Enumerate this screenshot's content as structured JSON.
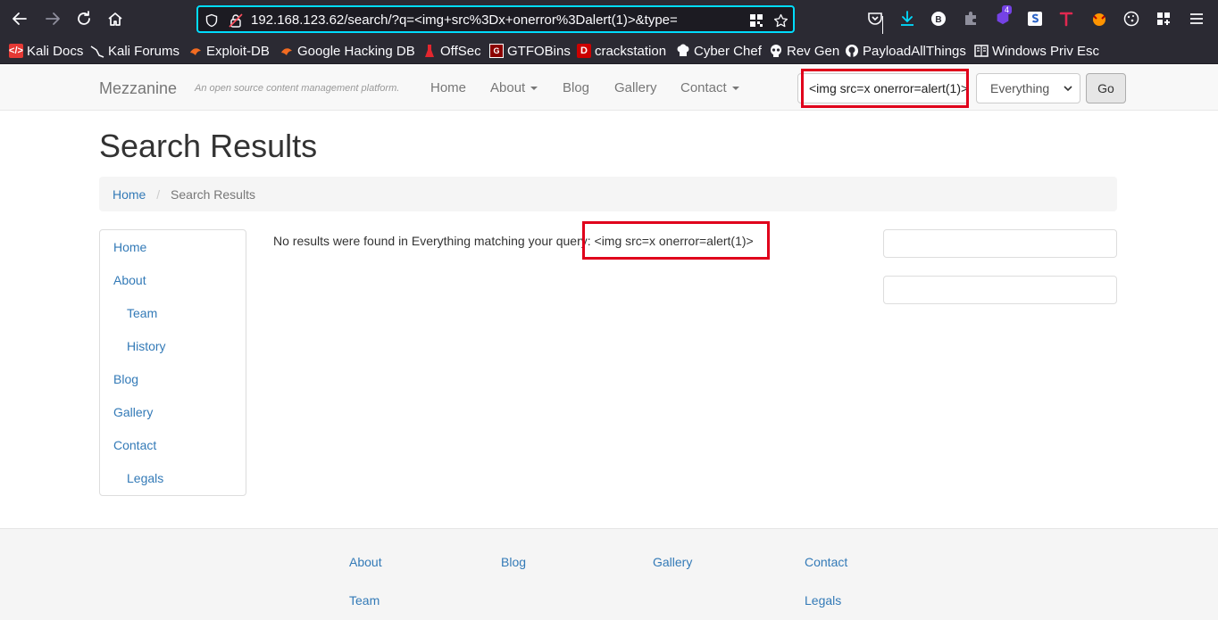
{
  "browser": {
    "url": "192.168.123.62/search/?q=<img+src%3Dx+onerror%3Dalert(1)>&type=",
    "extension_badge": "4",
    "bookmarks": [
      {
        "label": "Kali Docs"
      },
      {
        "label": "Kali Forums"
      },
      {
        "label": "Exploit-DB"
      },
      {
        "label": "Google Hacking DB"
      },
      {
        "label": "OffSec"
      },
      {
        "label": "GTFOBins"
      },
      {
        "label": "crackstation"
      },
      {
        "label": "Cyber Chef"
      },
      {
        "label": "Rev Gen"
      },
      {
        "label": "PayloadAllThings"
      },
      {
        "label": "Windows Priv Esc"
      }
    ]
  },
  "navbar": {
    "brand": "Mezzanine",
    "tagline": "An open source content management platform.",
    "links": [
      {
        "label": "Home"
      },
      {
        "label": "About"
      },
      {
        "label": "Blog"
      },
      {
        "label": "Gallery"
      },
      {
        "label": "Contact"
      }
    ],
    "search_value": "<img src=x onerror=alert(1)>",
    "type_selected": "Everything",
    "go_label": "Go"
  },
  "main": {
    "title": "Search Results",
    "breadcrumb": [
      {
        "label": "Home"
      },
      {
        "label": "Search Results"
      }
    ],
    "result_prefix": "No results were found in Everything matching your query: ",
    "result_query": "<img src=x onerror=alert(1)>"
  },
  "sidebar": {
    "items": [
      {
        "label": "Home"
      },
      {
        "label": "About"
      },
      {
        "label": "Team"
      },
      {
        "label": "History"
      },
      {
        "label": "Blog"
      },
      {
        "label": "Gallery"
      },
      {
        "label": "Contact"
      },
      {
        "label": "Legals"
      }
    ]
  },
  "footer": {
    "links": [
      {
        "label": "About"
      },
      {
        "label": "Blog"
      },
      {
        "label": "Gallery"
      },
      {
        "label": "Contact"
      },
      {
        "label": "Team"
      },
      {
        "label": "Legals"
      }
    ]
  },
  "colors": {
    "highlight": "#e0001b",
    "link": "#337ab7",
    "chrome_bg": "#2b2a33",
    "url_focus": "#00ddff"
  }
}
